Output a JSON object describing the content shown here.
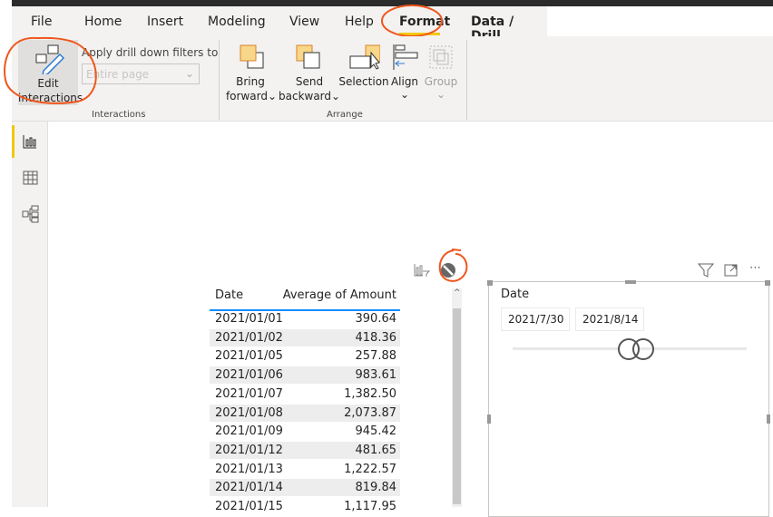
{
  "ribbon": {
    "tabs": [
      "File",
      "Home",
      "Insert",
      "Modeling",
      "View",
      "Help",
      "Format",
      "Data / Drill"
    ],
    "active_tab": "Format",
    "edit_interactions": [
      "Edit",
      "interactions"
    ],
    "apply_drill_label": "Apply drill down filters to",
    "drill_select_value": "Entire page",
    "bring_forward": [
      "Bring",
      "forward"
    ],
    "send_backward": [
      "Send",
      "backward"
    ],
    "selection": "Selection",
    "align": "Align",
    "group": "Group",
    "group_interactions": "Interactions",
    "group_arrange": "Arrange"
  },
  "accent": "#f2c811",
  "annotation_color": "#f0561d",
  "table": {
    "headers": [
      "Date",
      "Average of Amount"
    ],
    "rows": [
      [
        "2021/01/01",
        "390.64"
      ],
      [
        "2021/01/02",
        "418.36"
      ],
      [
        "2021/01/05",
        "257.88"
      ],
      [
        "2021/01/06",
        "983.61"
      ],
      [
        "2021/01/07",
        "1,382.50"
      ],
      [
        "2021/01/08",
        "2,073.87"
      ],
      [
        "2021/01/09",
        "945.42"
      ],
      [
        "2021/01/12",
        "481.65"
      ],
      [
        "2021/01/13",
        "1,222.57"
      ],
      [
        "2021/01/14",
        "819.84"
      ],
      [
        "2021/01/15",
        "1,117.95"
      ]
    ]
  },
  "slicer": {
    "title": "Date",
    "start": "2021/7/30",
    "end": "2021/8/14"
  }
}
